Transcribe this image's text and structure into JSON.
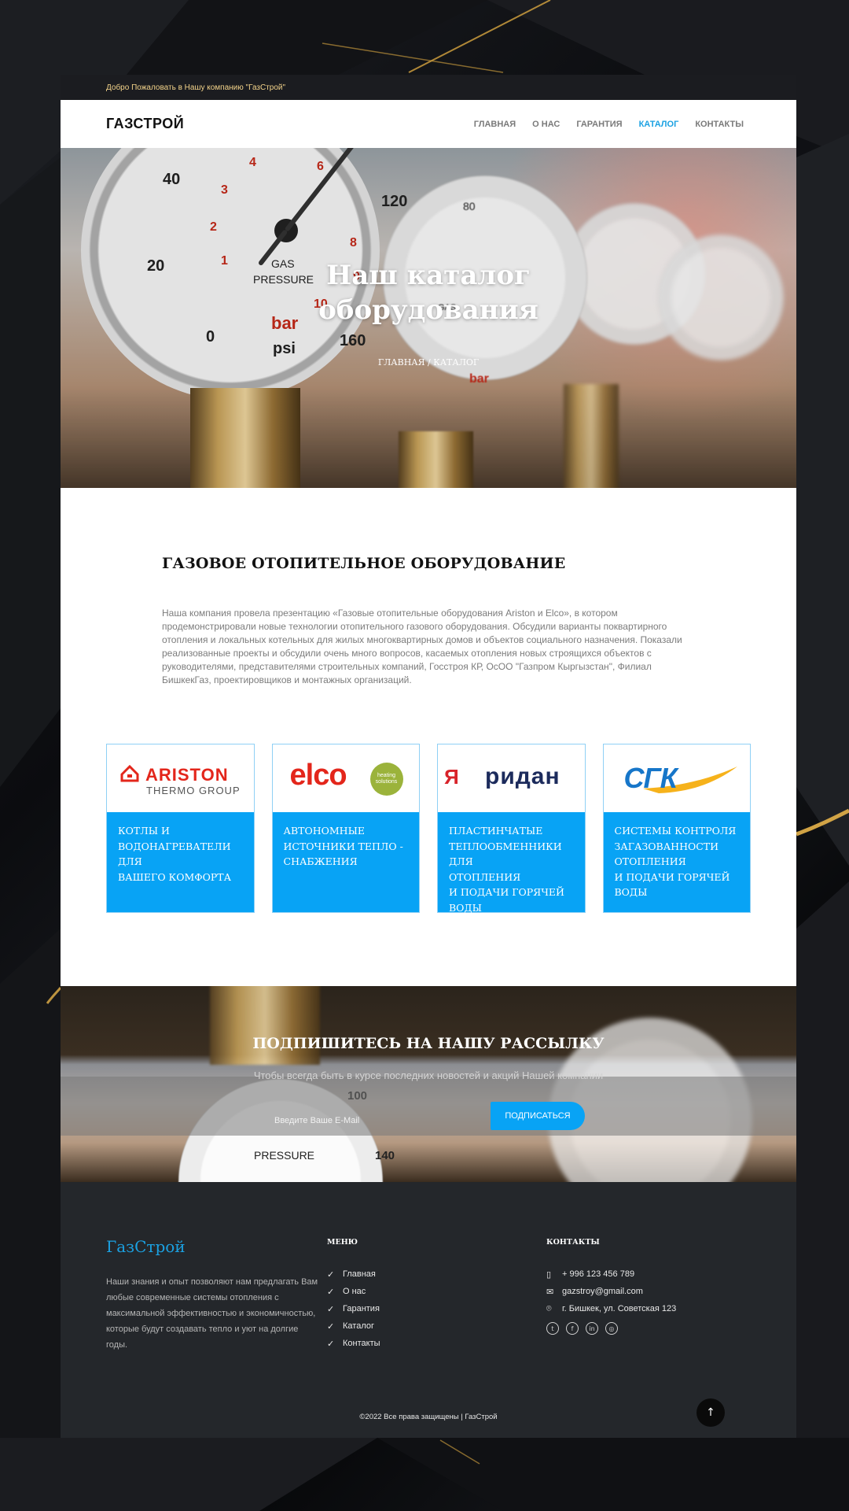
{
  "topbar": {
    "welcome": "Добро Пожаловать в Нашу компанию \"ГазСтрой\""
  },
  "header": {
    "logo": "ГАЗСТРОЙ",
    "nav": [
      {
        "label": "ГЛАВНАЯ",
        "active": false
      },
      {
        "label": "О НАС",
        "active": false
      },
      {
        "label": "ГАРАНТИЯ",
        "active": false
      },
      {
        "label": "КАТАЛОГ",
        "active": true
      },
      {
        "label": "КОНТАКТЫ",
        "active": false
      }
    ]
  },
  "hero": {
    "title_line1": "Наш каталог",
    "title_line2": "оборудования",
    "breadcrumb": "ГЛАВНАЯ / КАТАЛОГ",
    "gauge_labels": {
      "gas": "GAS",
      "pressure": "PRESSURE",
      "bar": "bar",
      "psi": "psi",
      "n20": "20",
      "n40": "40",
      "n120": "120",
      "n160": "160",
      "n0": "0",
      "r1": "1",
      "r2": "2",
      "r3": "3",
      "r4": "4",
      "r6": "6",
      "r8": "8",
      "r9": "9",
      "r10": "10",
      "s80": "80",
      "s100": "100"
    }
  },
  "section": {
    "heading": "ГАЗОВОЕ ОТОПИТЕЛЬНОЕ ОБОРУДОВАНИЕ",
    "text": "Наша компания провела презентацию «Газовые отопительные оборудования Ariston и Elco», в котором продемонстрировали новые технологии отопительного газового оборудования. Обсудили варианты поквартирного отопления и локальных котельных для жилых многоквартирных домов и объектов социального назначения. Показали реализованные проекты и обсудили очень много вопросов, касаемых отопления новых строящихся объектов с руководителями, представителями строительных компаний, Госстроя КР, ОсОО \"Газпром Кыргызстан\", Филиал БишкекГаз, проектировщиков и монтажных организаций."
  },
  "cards": [
    {
      "brand": "ARISTON",
      "brand_sub": "THERMO GROUP",
      "line1": "КОТЛЫ И",
      "line2": "ВОДОНАГРЕВАТЕЛИ ДЛЯ",
      "line3": "ВАШЕГО КОМФОРТА",
      "line4": "",
      "line5": ""
    },
    {
      "brand": "elco",
      "brand_sub": "heating solutions",
      "line1": "АВТОНОМНЫЕ",
      "line2": "ИСТОЧНИКИ ТЕПЛО -",
      "line3": "СНАБЖЕНИЯ",
      "line4": "",
      "line5": ""
    },
    {
      "brand": "ридан",
      "brand_sub": "R",
      "line1": "ПЛАСТИНЧАТЫЕ",
      "line2": "ТЕПЛООБМЕННИКИ ДЛЯ",
      "line3": "ОТОПЛЕНИЯ",
      "line4": "И ПОДАЧИ ГОРЯЧЕЙ",
      "line5": "ВОДЫ"
    },
    {
      "brand": "СГК",
      "brand_sub": "",
      "line1": "СИСТЕМЫ КОНТРОЛЯ",
      "line2": "ЗАГАЗОВАННОСТИ",
      "line3": "ОТОПЛЕНИЯ",
      "line4": "И ПОДАЧИ ГОРЯЧЕЙ",
      "line5": "ВОДЫ"
    }
  ],
  "newsletter": {
    "title": "ПОДПИШИТЕСЬ НА НАШУ РАССЫЛКУ",
    "subtitle": "Чтобы всегда быть в курсе последних новостей и акций Нашей компании",
    "placeholder": "Введите Ваше E-Mail",
    "button": "ПОДПИСАТЬСЯ"
  },
  "footer": {
    "brand": "ГазСтрой",
    "about": "Наши знания и опыт позволяют нам предлагать Вам любые современные системы отопления с максимальной эффективностью и экономичностью, которые будут создавать тепло и уют на долгие годы.",
    "menu_title": "МЕНЮ",
    "menu": [
      "Главная",
      "О нас",
      "Гарантия",
      "Каталог",
      "Контакты"
    ],
    "contacts_title": "КОНТАКТЫ",
    "phone": "+ 996 123 456 789",
    "email": "gazstroy@gmail.com",
    "address": "г. Бишкек, ул. Советская 123",
    "social_icons": [
      "twitter-icon",
      "facebook-icon",
      "linkedin-icon",
      "instagram-icon"
    ],
    "copyright": "©2022 Все права защищены | ГазСтрой"
  },
  "colors": {
    "accent": "#08a3f5",
    "footer_bg": "#24272b",
    "topbar_text": "#f3d38a"
  }
}
